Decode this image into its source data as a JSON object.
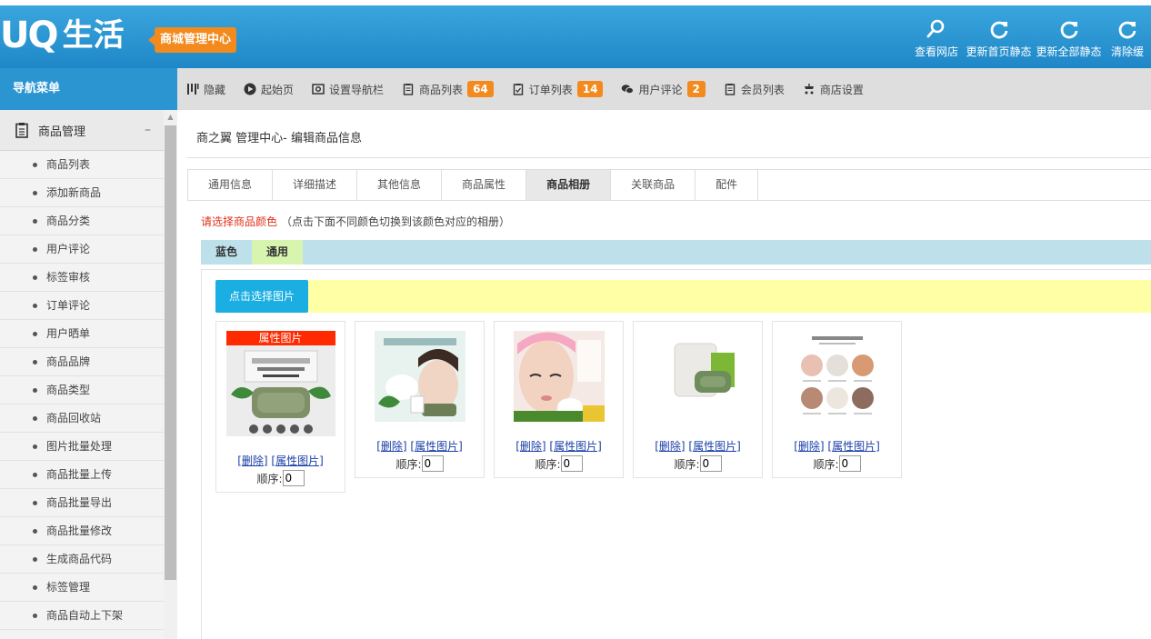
{
  "header": {
    "logo_mark": "UQ",
    "logo_text": "生活",
    "badge": "商城管理中心",
    "actions": [
      {
        "label": "查看网店",
        "icon": "search-icon"
      },
      {
        "label": "更新首页静态",
        "icon": "refresh-icon"
      },
      {
        "label": "更新全部静态",
        "icon": "refresh-icon"
      },
      {
        "label": "清除缓",
        "icon": "refresh-icon"
      }
    ]
  },
  "nav": {
    "title": "导航菜单",
    "items": [
      {
        "label": "隐藏",
        "icon": "columns-icon"
      },
      {
        "label": "起始页",
        "icon": "play-circle-icon"
      },
      {
        "label": "设置导航栏",
        "icon": "settings-icon"
      },
      {
        "label": "商品列表",
        "icon": "clipboard-icon",
        "badge": "64"
      },
      {
        "label": "订单列表",
        "icon": "clipboard-check-icon",
        "badge": "14"
      },
      {
        "label": "用户评论",
        "icon": "chat-icon",
        "badge": "2"
      },
      {
        "label": "会员列表",
        "icon": "clipboard-icon"
      },
      {
        "label": "商店设置",
        "icon": "shop-icon"
      }
    ]
  },
  "sidebar": {
    "section": "商品管理",
    "items": [
      "商品列表",
      "添加新商品",
      "商品分类",
      "用户评论",
      "标签审核",
      "订单评论",
      "用户晒单",
      "商品品牌",
      "商品类型",
      "商品回收站",
      "图片批量处理",
      "商品批量上传",
      "商品批量导出",
      "商品批量修改",
      "生成商品代码",
      "标签管理",
      "商品自动上下架"
    ]
  },
  "main": {
    "title": "商之翼 管理中心- 编辑商品信息",
    "tabs": [
      "通用信息",
      "详细描述",
      "其他信息",
      "商品属性",
      "商品相册",
      "关联商品",
      "配件"
    ],
    "active_tab": "商品相册",
    "color_hint_red": "请选择商品颜色",
    "color_hint": "（点击下面不同颜色切换到该颜色对应的相册）",
    "colors": [
      "蓝色",
      "通用"
    ],
    "active_color": "通用",
    "upload_button": "点击选择图片",
    "cards": [
      {
        "prop_label": "属性图片",
        "delete": "[删除]",
        "set_prop": "[属性图片]",
        "order_label": "顺序:",
        "order": "0",
        "img": "soap-box"
      },
      {
        "delete": "[删除]",
        "set_prop": "[属性图片]",
        "order_label": "顺序:",
        "order": "0",
        "img": "foam-face"
      },
      {
        "delete": "[删除]",
        "set_prop": "[属性图片]",
        "order_label": "顺序:",
        "order": "0",
        "img": "woman-face"
      },
      {
        "delete": "[删除]",
        "set_prop": "[属性图片]",
        "order_label": "顺序:",
        "order": "0",
        "img": "soap-pack"
      },
      {
        "delete": "[删除]",
        "set_prop": "[属性图片]",
        "order_label": "顺序:",
        "order": "0",
        "img": "skin-chart"
      }
    ]
  }
}
